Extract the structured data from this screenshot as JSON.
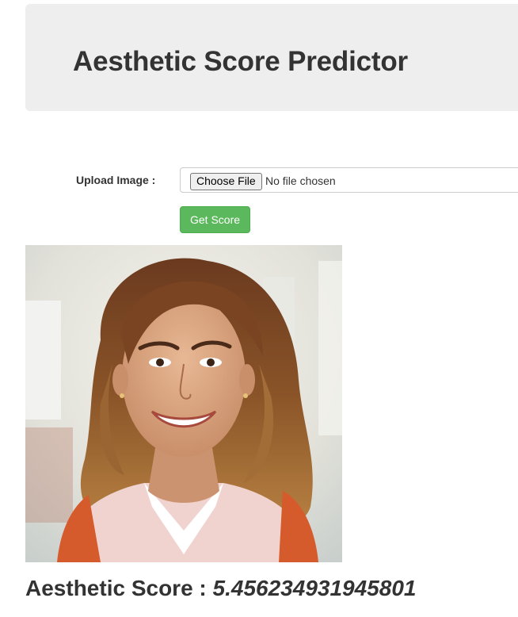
{
  "header": {
    "title": "Aesthetic Score Predictor"
  },
  "form": {
    "upload_label": "Upload Image :",
    "choose_file_label": "Choose File",
    "no_file_text": "No file chosen",
    "submit_label": "Get Score"
  },
  "result": {
    "label": "Aesthetic Score : ",
    "value": "5.456234931945801"
  },
  "colors": {
    "header_bg": "#eeeeee",
    "button_green": "#5cb85c",
    "text": "#333333"
  }
}
